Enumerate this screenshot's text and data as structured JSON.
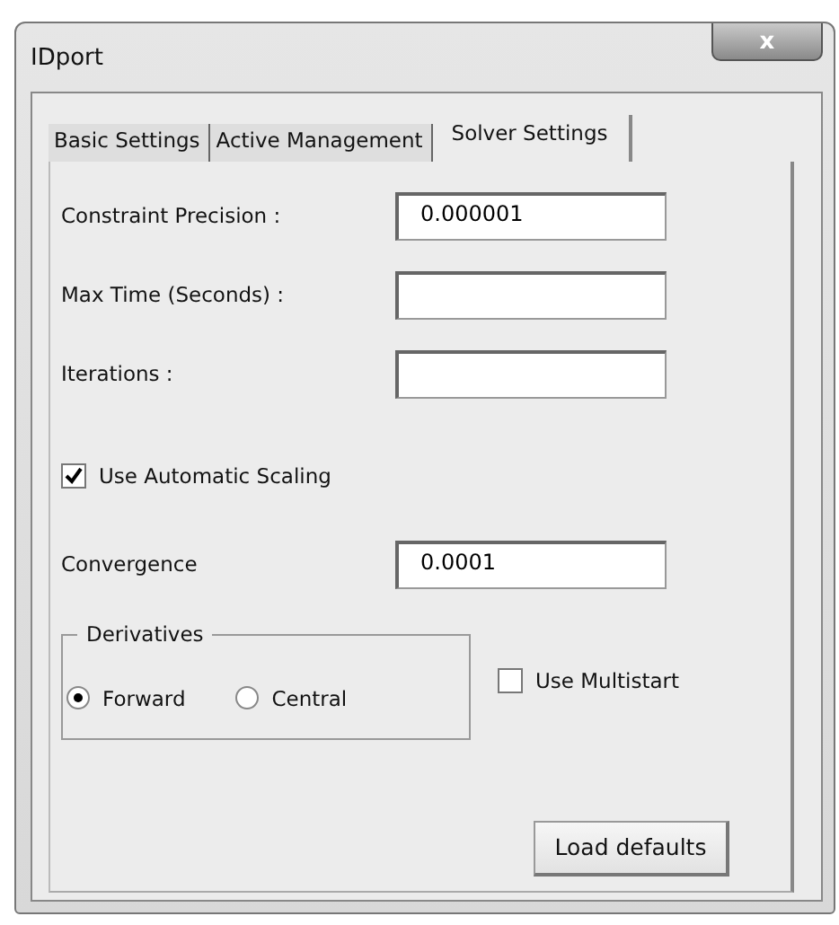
{
  "window": {
    "title": "IDport",
    "close": "x"
  },
  "tabs": [
    {
      "label": "Basic Settings",
      "selected": false
    },
    {
      "label": "Active Management",
      "selected": false
    },
    {
      "label": "Solver Settings",
      "selected": true
    }
  ],
  "fields": [
    {
      "label": "Constraint Precision :",
      "value": "0.000001"
    },
    {
      "label": "Max Time (Seconds) :"
    },
    {
      "label": "Iterations :"
    }
  ],
  "automatic_scaling": {
    "label": "Use Automatic Scaling",
    "checked": true
  },
  "convergence": {
    "label": "Convergence",
    "value": "0.0001"
  },
  "derivatives": {
    "title": "Derivatives",
    "options": [
      {
        "label": "Forward",
        "selected": true
      },
      {
        "label": "Central",
        "selected": false
      }
    ]
  },
  "multistart": {
    "label": "Use Multistart",
    "checked": false
  },
  "load_defaults": "Load defaults"
}
